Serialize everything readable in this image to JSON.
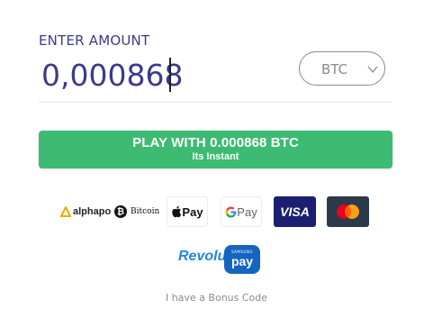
{
  "form": {
    "label": "ENTER AMOUNT",
    "amount_value": "0,000868",
    "currency": "BTC"
  },
  "play_button": {
    "main_label": "PLAY WITH 0.000868 BTC",
    "sub_label": "Its Instant"
  },
  "payment_methods": {
    "alphapo": "alphapo",
    "bitcoin": "Bitcoin",
    "apple_pay": "Pay",
    "google_pay": "Pay",
    "visa": "VISA",
    "revolut": "Revolut",
    "samsung_top": "SAMSUNG",
    "samsung_pay": "pay"
  },
  "bonus_link": "I have a Bonus Code",
  "colors": {
    "accent_text": "#3d3a8c",
    "button_green": "#3dbb72",
    "visa_blue": "#1a1f71",
    "mastercard_red": "#eb001b",
    "mastercard_orange": "#f79e1b"
  }
}
